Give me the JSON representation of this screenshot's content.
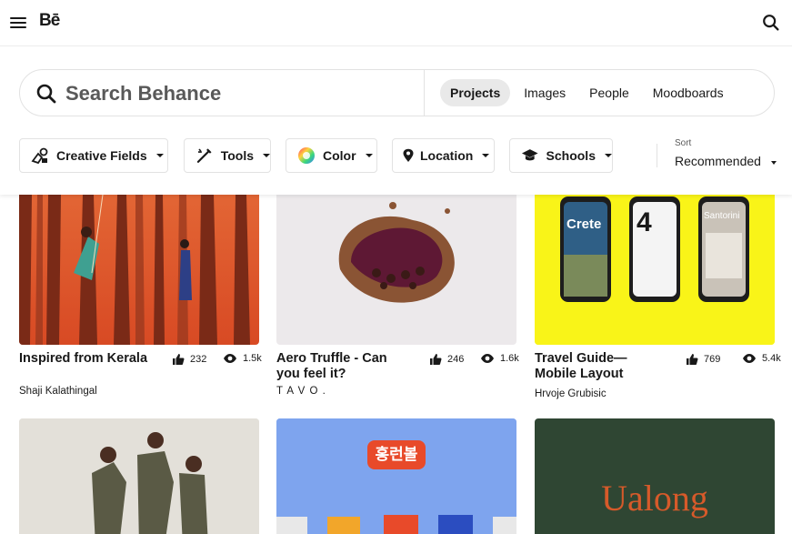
{
  "app": {
    "logo": "Bē",
    "menu_icon": "hamburger-menu-icon",
    "search_icon": "search-icon"
  },
  "search": {
    "placeholder": "Search Behance",
    "value": ""
  },
  "tabs": [
    {
      "label": "Projects",
      "active": true
    },
    {
      "label": "Images",
      "active": false
    },
    {
      "label": "People",
      "active": false
    },
    {
      "label": "Moodboards",
      "active": false
    }
  ],
  "filters": {
    "creative_fields": "Creative Fields",
    "tools": "Tools",
    "color": "Color",
    "location": "Location",
    "schools": "Schools",
    "sort_label": "Sort",
    "sort_value": "Recommended"
  },
  "projects": [
    {
      "title": "Inspired from Kerala",
      "owner": "Shaji Kalathingal",
      "likes": "232",
      "views": "1.5k"
    },
    {
      "title": "Aero Truffle - Can you feel it?",
      "owner": "T A V O .",
      "likes": "246",
      "views": "1.6k"
    },
    {
      "title": "Travel Guide— Mobile Layout",
      "owner": "Hrvoje Grubisic",
      "likes": "769",
      "views": "5.4k"
    }
  ],
  "thumb_text": {
    "crete": "Crete",
    "four": "4",
    "santorini": "Santorini",
    "korean": "홍런볼",
    "ualong": "Ualong"
  },
  "colors": {
    "accent": "#191919",
    "kerala_bg": "#e0552a",
    "truffle_bg": "#ece9eb",
    "travel_bg": "#f9f418",
    "dance_bg": "#e3e0d9",
    "snack_bg": "#7ea4ee",
    "ualong_bg": "#2f4633",
    "ualong_text": "#d65a2a"
  }
}
